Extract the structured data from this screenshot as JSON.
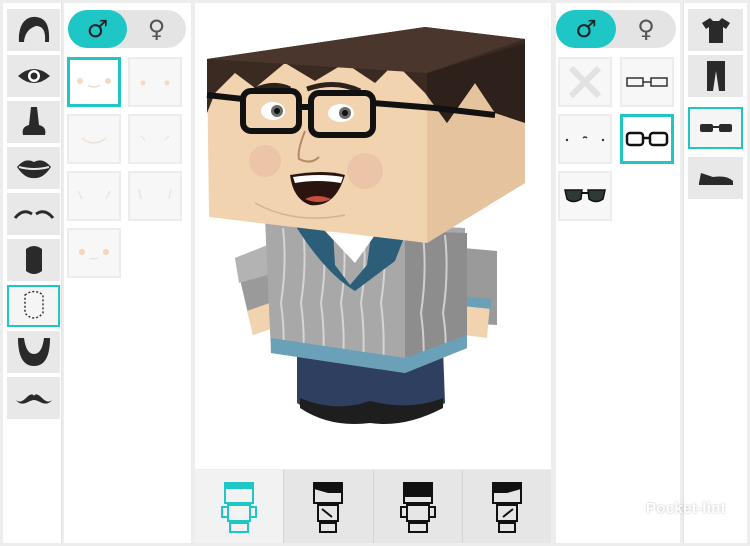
{
  "left_categories": [
    {
      "icon": "hair-icon",
      "selected": false
    },
    {
      "icon": "eye-icon",
      "selected": false
    },
    {
      "icon": "nose-icon",
      "selected": false
    },
    {
      "icon": "lips-icon",
      "selected": false
    },
    {
      "icon": "eyebrows-icon",
      "selected": false
    },
    {
      "icon": "ear-icon",
      "selected": false
    },
    {
      "icon": "face-shape-icon",
      "selected": true
    },
    {
      "icon": "beard-icon",
      "selected": false
    },
    {
      "icon": "mustache-icon",
      "selected": false
    }
  ],
  "gender_toggle": {
    "male_symbol": "♂",
    "female_symbol": "♀",
    "selected": "male"
  },
  "left_options": {
    "count": 7,
    "selected_index": 0
  },
  "right_options": [
    {
      "icon": "none-x-icon",
      "selected": false
    },
    {
      "icon": "thin-rectangle-glasses-icon",
      "selected": false
    },
    {
      "icon": "rimless-glasses-icon",
      "selected": false
    },
    {
      "icon": "black-frame-glasses-icon",
      "selected": true
    },
    {
      "icon": "sunglasses-icon",
      "selected": false
    }
  ],
  "right_categories": [
    {
      "icon": "shirt-icon",
      "selected": false
    },
    {
      "icon": "pants-icon",
      "selected": false
    },
    {
      "icon": "glasses-icon",
      "selected": true
    },
    {
      "icon": "shoe-icon",
      "selected": false
    }
  ],
  "bottom_views": [
    {
      "icon": "character-front-view-icon",
      "active": true
    },
    {
      "icon": "character-side-left-view-icon",
      "active": false
    },
    {
      "icon": "character-back-view-icon",
      "active": false
    },
    {
      "icon": "character-side-right-view-icon",
      "active": false
    }
  ],
  "watermark": "Pocket-lint",
  "colors": {
    "accent": "#1ec6c6",
    "hair": "#3a2a22",
    "skin": "#f2d3b0",
    "sweater": "#9a9a9a",
    "collar": "#2c5e7a",
    "pants": "#2f3f60"
  }
}
